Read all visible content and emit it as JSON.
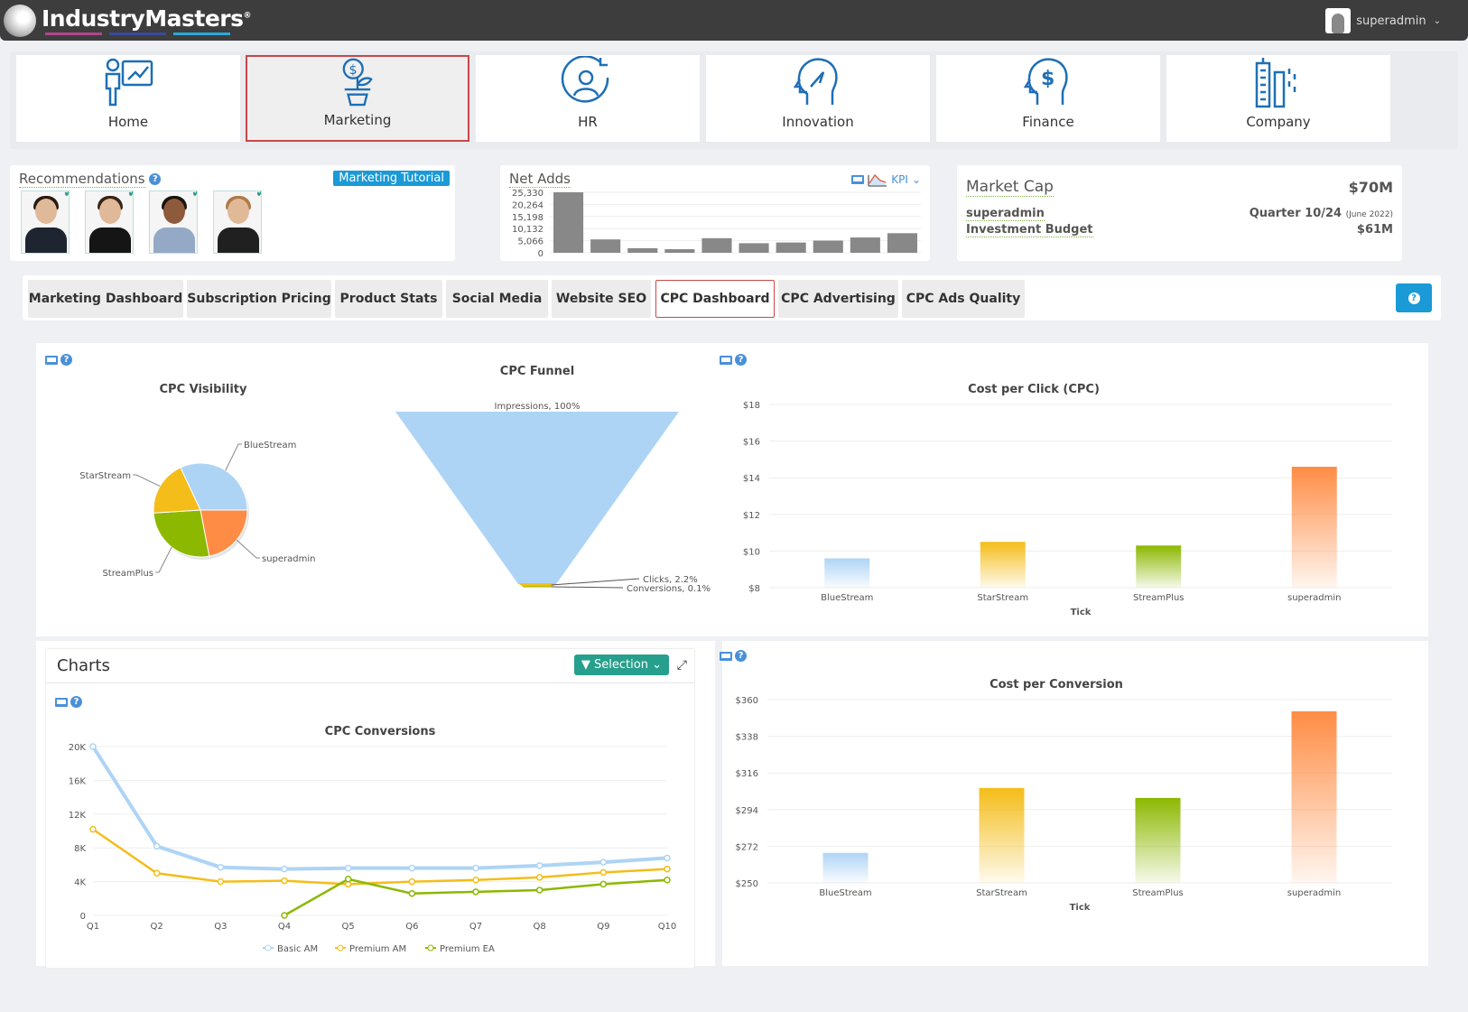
{
  "app": {
    "brand": "IndustryMasters",
    "brand_mark": "®",
    "brand_bar_colors": [
      "#b0458f",
      "#3b4a9c",
      "#2ba8d8"
    ],
    "user": "superadmin"
  },
  "nav": {
    "items": [
      {
        "label": "Home",
        "icon": "presenter-chart-icon",
        "active": false
      },
      {
        "label": "Marketing",
        "icon": "money-plant-icon",
        "active": true
      },
      {
        "label": "HR",
        "icon": "person-cycle-icon",
        "active": false
      },
      {
        "label": "Innovation",
        "icon": "head-idea-icon",
        "active": false
      },
      {
        "label": "Finance",
        "icon": "head-dollar-icon",
        "active": false
      },
      {
        "label": "Company",
        "icon": "buildings-icon",
        "active": false
      }
    ]
  },
  "recommendations": {
    "title": "Recommendations",
    "tutorial_label": "Marketing Tutorial",
    "people": [
      {
        "name": "advisor-1",
        "checked": true
      },
      {
        "name": "advisor-2",
        "checked": true
      },
      {
        "name": "advisor-3",
        "checked": true
      },
      {
        "name": "advisor-4",
        "checked": true
      }
    ]
  },
  "net_adds": {
    "title": "Net Adds",
    "kpi_label": "KPI",
    "y_ticks": [
      "25,330",
      "20,264",
      "15,198",
      "10,132",
      "5,066",
      "0"
    ],
    "y_max": 25330,
    "values": [
      25330,
      5600,
      1900,
      1500,
      6100,
      4000,
      4300,
      5100,
      6400,
      8200
    ]
  },
  "market_cap": {
    "title": "Market Cap",
    "value": "$70M",
    "user": "superadmin",
    "quarter": "Quarter 10/24",
    "quarter_date": "(June 2022)",
    "budget_label": "Investment Budget",
    "budget_value": "$61M"
  },
  "tabs": [
    {
      "label": "Marketing Dashboard",
      "active": false
    },
    {
      "label": "Subscription Pricing",
      "active": false
    },
    {
      "label": "Product Stats",
      "active": false
    },
    {
      "label": "Social Media",
      "active": false
    },
    {
      "label": "Website SEO",
      "active": false
    },
    {
      "label": "CPC Dashboard",
      "active": true
    },
    {
      "label": "CPC Advertising",
      "active": false
    },
    {
      "label": "CPC Ads Quality",
      "active": false
    }
  ],
  "charts_panel": {
    "title": "Charts",
    "selection_label": "Selection"
  },
  "colors": {
    "BlueStream": "#aed4f5",
    "StarStream": "#f4bd19",
    "StreamPlus": "#8cb800",
    "superadmin": "#ff8c44"
  },
  "chart_data": [
    {
      "id": "cpc_visibility",
      "type": "pie",
      "title": "CPC Visibility",
      "labels": [
        "BlueStream",
        "superadmin",
        "StreamPlus",
        "StarStream"
      ],
      "values": [
        32,
        22,
        27,
        19
      ]
    },
    {
      "id": "cpc_funnel",
      "type": "funnel",
      "title": "CPC Funnel",
      "stages": [
        {
          "label": "Impressions, 100%",
          "value": 100
        },
        {
          "label": "Clicks, 2.2%",
          "value": 2.2
        },
        {
          "label": "Conversions, 0.1%",
          "value": 0.1
        }
      ]
    },
    {
      "id": "cpc_bar",
      "type": "bar",
      "title": "Cost per Click (CPC)",
      "xlabel": "Tick",
      "categories": [
        "BlueStream",
        "StarStream",
        "StreamPlus",
        "superadmin"
      ],
      "values": [
        9.6,
        10.5,
        10.3,
        14.6
      ],
      "y_ticks": [
        "$18",
        "$16",
        "$14",
        "$12",
        "$10",
        "$8"
      ],
      "ylim": [
        8,
        18
      ]
    },
    {
      "id": "cpc_conversions",
      "type": "line",
      "title": "CPC Conversions",
      "x": [
        "Q1",
        "Q2",
        "Q3",
        "Q4",
        "Q5",
        "Q6",
        "Q7",
        "Q8",
        "Q9",
        "Q10"
      ],
      "y_ticks": [
        "20K",
        "16K",
        "12K",
        "8K",
        "4K",
        "0"
      ],
      "ylim": [
        0,
        20000
      ],
      "series": [
        {
          "name": "Basic AM",
          "color": "#aed4f5",
          "values": [
            20000,
            8200,
            5700,
            5500,
            5600,
            5600,
            5600,
            5900,
            6300,
            6800
          ]
        },
        {
          "name": "Premium AM",
          "color": "#f4bd19",
          "values": [
            10200,
            5000,
            4000,
            4100,
            3700,
            4000,
            4200,
            4500,
            5100,
            5500
          ]
        },
        {
          "name": "Premium EA",
          "color": "#8cb800",
          "values": [
            null,
            null,
            null,
            0,
            4300,
            2600,
            2800,
            3000,
            3700,
            4200
          ]
        }
      ]
    },
    {
      "id": "cost_per_conversion",
      "type": "bar",
      "title": "Cost per Conversion",
      "xlabel": "Tick",
      "categories": [
        "BlueStream",
        "StarStream",
        "StreamPlus",
        "superadmin"
      ],
      "values": [
        268,
        307,
        301,
        353
      ],
      "y_ticks": [
        "$360",
        "$338",
        "$316",
        "$294",
        "$272",
        "$250"
      ],
      "ylim": [
        250,
        360
      ]
    }
  ]
}
